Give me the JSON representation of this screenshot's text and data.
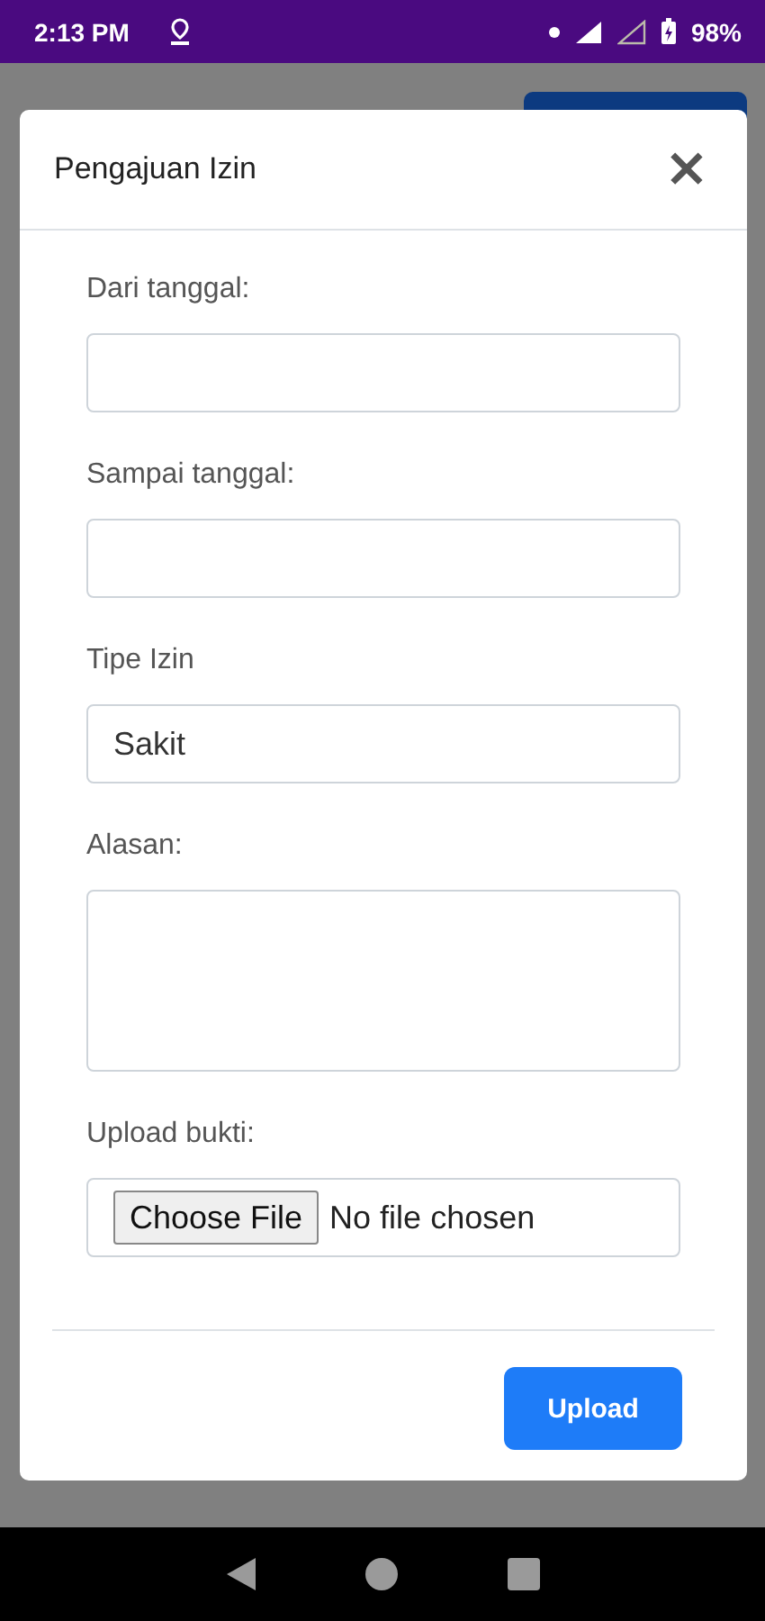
{
  "status_bar": {
    "time": "2:13 PM",
    "battery": "98%"
  },
  "modal": {
    "title": "Pengajuan Izin",
    "close": "×",
    "fields": [
      {
        "kind": "date",
        "label": "Dari tanggal:"
      },
      {
        "kind": "date",
        "label": "Sampai tanggal:"
      },
      {
        "kind": "select",
        "label": "Tipe Izin",
        "value": "Sakit"
      },
      {
        "kind": "textarea",
        "label": "Alasan:"
      },
      {
        "kind": "file",
        "label": "Upload bukti:",
        "button": "Choose File",
        "status": "No file chosen"
      }
    ],
    "submit": "Upload"
  }
}
